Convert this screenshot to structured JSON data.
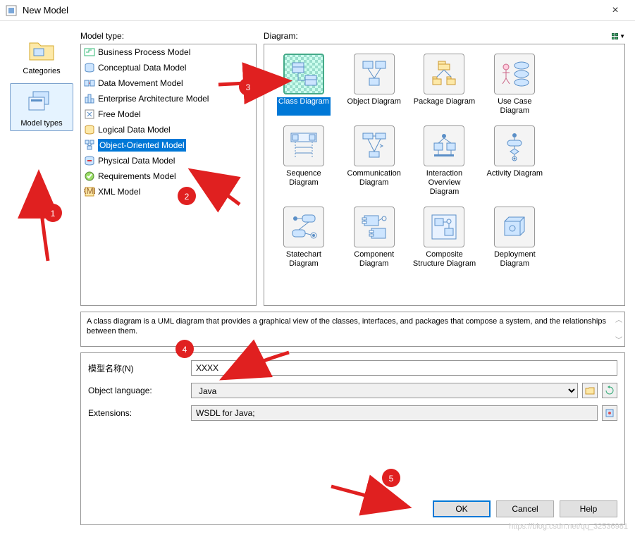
{
  "window": {
    "title": "New Model",
    "close_label": "×"
  },
  "left_rail": {
    "categories_label": "Categories",
    "model_types_label": "Model types"
  },
  "model_type": {
    "label": "Model type:",
    "items": [
      "Business Process Model",
      "Conceptual Data Model",
      "Data Movement Model",
      "Enterprise Architecture Model",
      "Free Model",
      "Logical Data Model",
      "Object-Oriented Model",
      "Physical Data Model",
      "Requirements Model",
      "XML Model"
    ],
    "selected_index": 6
  },
  "diagram": {
    "label": "Diagram:",
    "items": [
      "Class Diagram",
      "Object Diagram",
      "Package Diagram",
      "Use Case Diagram",
      "Sequence Diagram",
      "Communication Diagram",
      "Interaction Overview Diagram",
      "Activity Diagram",
      "Statechart Diagram",
      "Component Diagram",
      "Composite Structure Diagram",
      "Deployment Diagram"
    ],
    "selected_index": 0
  },
  "description": "A class diagram is a UML diagram that provides a graphical view of the classes, interfaces, and packages that compose a system, and the relationships between them.",
  "form": {
    "name_label": "模型名称(N)",
    "name_value": "XXXX",
    "lang_label": "Object language:",
    "lang_value": "Java",
    "ext_label": "Extensions:",
    "ext_value": "WSDL for Java;"
  },
  "buttons": {
    "ok": "OK",
    "cancel": "Cancel",
    "help": "Help"
  },
  "annotations": {
    "1": "1",
    "2": "2",
    "3": "3",
    "4": "4",
    "5": "5"
  },
  "watermark": "https://blog.csdn.net/qq_32536981"
}
